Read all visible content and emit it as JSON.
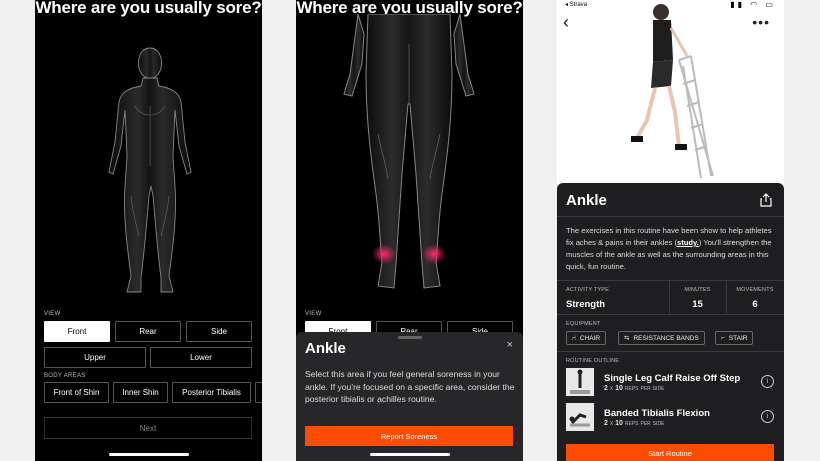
{
  "screen1": {
    "title": "Where are you usually sore?",
    "view_label": "VIEW",
    "view_buttons": [
      "Front",
      "Rear",
      "Side"
    ],
    "region_buttons": [
      "Upper",
      "Lower"
    ],
    "body_areas_label": "BODY AREAS",
    "body_areas": [
      "Front of Shin",
      "Inner Shin",
      "Posterior Tibialis"
    ],
    "next_label": "Next"
  },
  "screen2": {
    "title": "Where are you usually sore?",
    "view_label": "VIEW",
    "view_buttons": [
      "Front",
      "Rear",
      "Side"
    ],
    "sheet": {
      "title": "Ankle",
      "close": "×",
      "description": "Select this area if you feel general soreness in your ankle. If you're focused on a specific area, consider the posterior tibialis or achilles routine.",
      "button": "Report Soreness"
    }
  },
  "screen3": {
    "status_back": "◂ Strava",
    "routine_title": "Ankle",
    "desc_before": "The exercises in this routine have been show to help athletes fix aches & pains in their ankles (",
    "desc_link": "study.",
    "desc_after": ") You'll strengthen the muscles of the ankle as well as the surrounding areas in this quick, fun routine.",
    "activity_type_label": "ACTIVITY TYPE",
    "activity_type": "Strength",
    "minutes_label": "MINUTES",
    "minutes": "15",
    "movements_label": "MOVEMENTS",
    "movements": "6",
    "equipment_label": "EQUIPMENT",
    "equipment": [
      "CHAIR",
      "RESISTANCE BANDS",
      "STAIR"
    ],
    "outline_label": "ROUTINE OUTLINE",
    "exercises": [
      {
        "name": "Single Leg Calf Raise Off Step",
        "sets": "2",
        "x": "X",
        "reps": "10",
        "reps_label": "REPS",
        "per": "PER",
        "side": "SIDE"
      },
      {
        "name": "Banded Tibialis Flexion",
        "sets": "2",
        "x": "X",
        "reps": "10",
        "reps_label": "REPS",
        "per": "PER",
        "side": "SIDE"
      }
    ],
    "start_button": "Start Routine"
  },
  "colors": {
    "accent": "#fc4c02",
    "highlight": "#e0205a",
    "card": "#1e1e20"
  }
}
